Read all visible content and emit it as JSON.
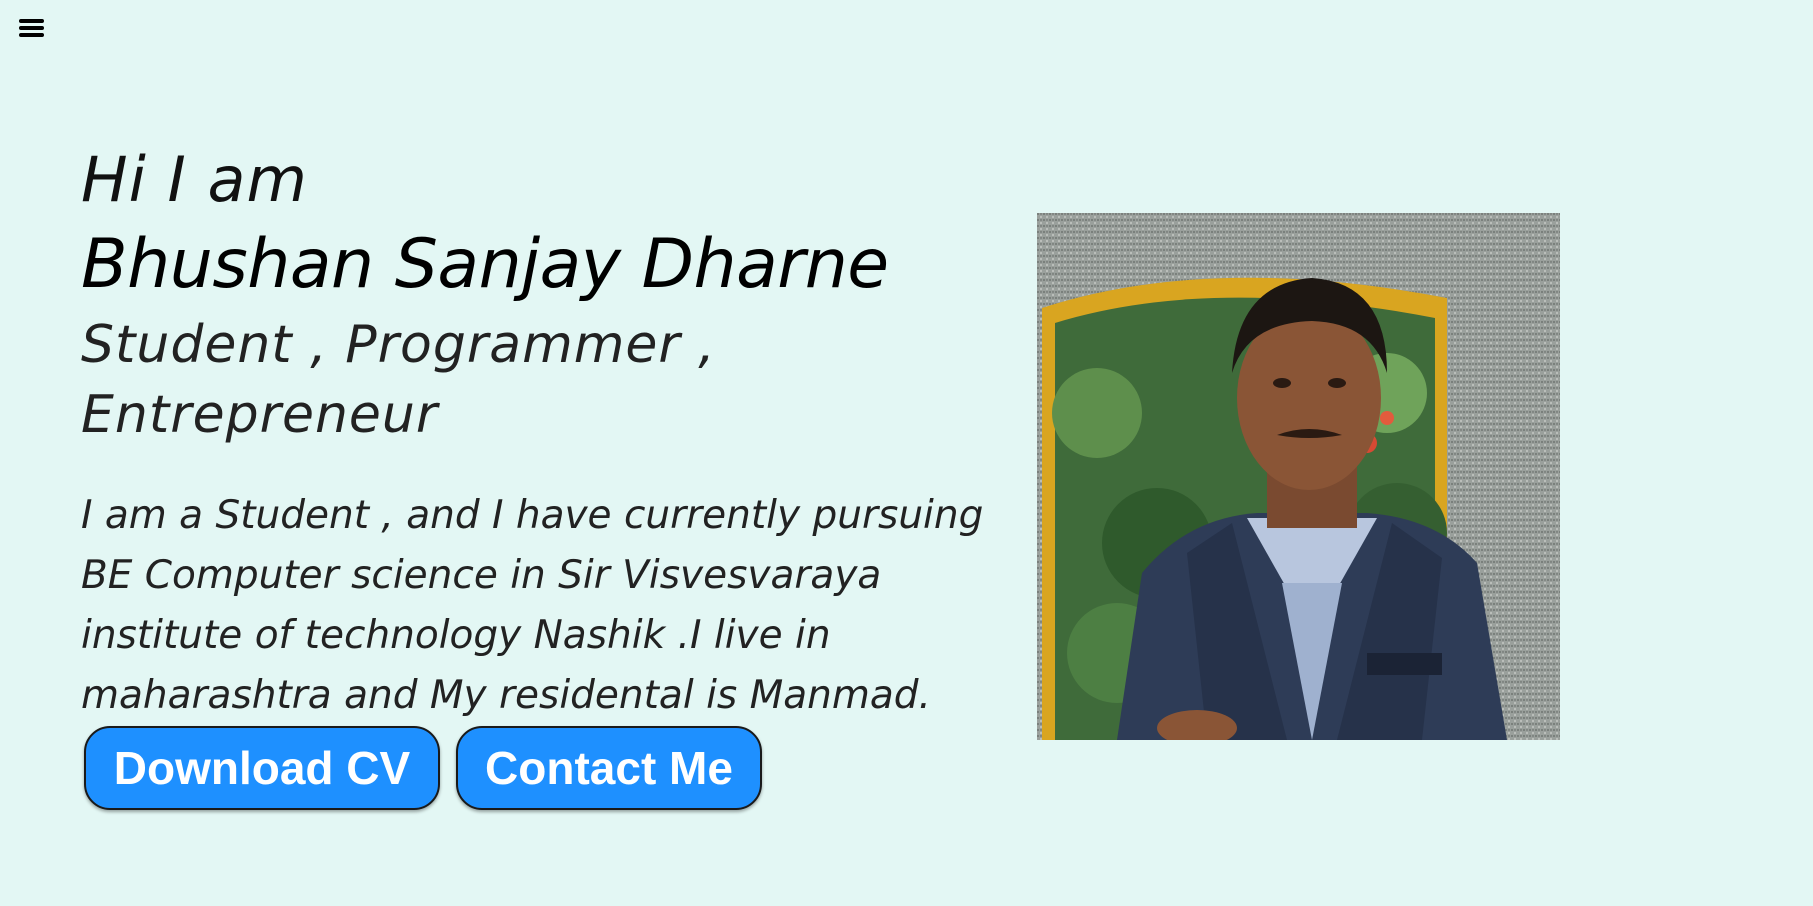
{
  "nav": {
    "menu_icon": "hamburger-menu-icon"
  },
  "hero": {
    "greeting": "Hi I am",
    "name": "Bhushan Sanjay Dharne",
    "roles": "Student , Programmer , Entrepreneur",
    "bio": "I am a Student , and I have currently pursuing BE Computer science in Sir Visvesvaraya institute of technology Nashik .I live in maharashtra and My residental is Manmad.",
    "buttons": {
      "download_cv": "Download CV",
      "contact_me": "Contact Me"
    }
  },
  "colors": {
    "background": "#e3f7f4",
    "button": "#1e90ff",
    "button_text": "#ffffff"
  }
}
